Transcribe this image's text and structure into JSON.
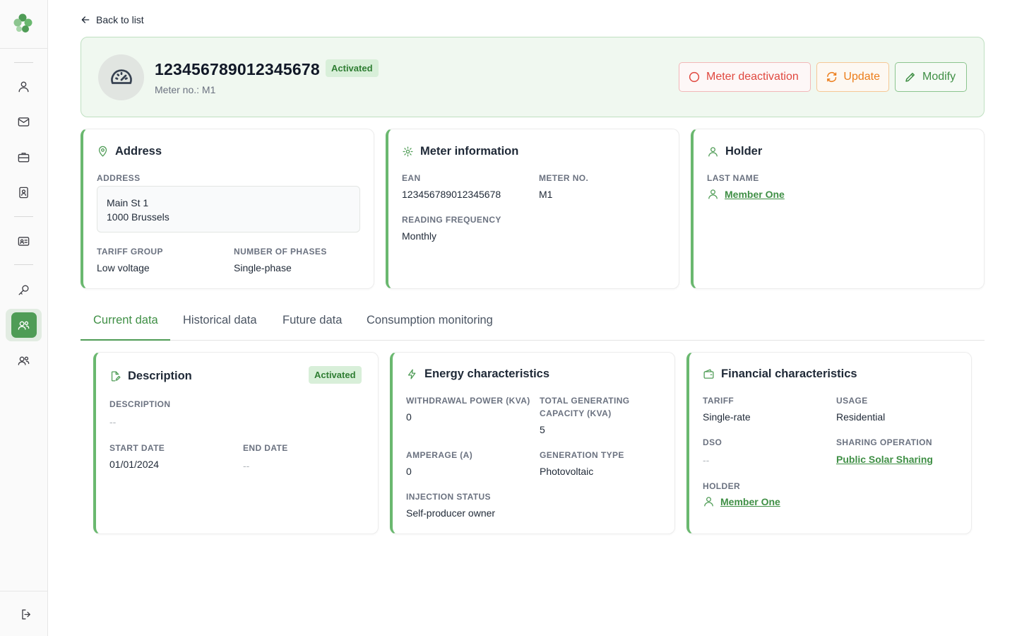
{
  "sidebar": {
    "logo": "clover-logo",
    "items": [
      {
        "icon": "user-icon"
      },
      {
        "icon": "mail-icon"
      },
      {
        "icon": "briefcase-icon"
      },
      {
        "icon": "contact-book-icon"
      },
      {
        "icon": "id-card-icon"
      },
      {
        "icon": "key-icon"
      },
      {
        "icon": "community-icon",
        "active": true
      },
      {
        "icon": "users-icon"
      }
    ],
    "logout_icon": "logout-icon"
  },
  "back_link": "Back to list",
  "header": {
    "title": "123456789012345678",
    "status": "Activated",
    "subtitle": "Meter no.: M1",
    "buttons": {
      "deactivate": "Meter deactivation",
      "update": "Update",
      "modify": "Modify"
    }
  },
  "address_card": {
    "title": "Address",
    "address_label": "ADDRESS",
    "address_line1": "Main St 1",
    "address_line2": "1000 Brussels",
    "tariff_group_label": "TARIFF GROUP",
    "tariff_group": "Low voltage",
    "phases_label": "NUMBER OF PHASES",
    "phases": "Single-phase"
  },
  "meter_card": {
    "title": "Meter information",
    "ean_label": "EAN",
    "ean": "123456789012345678",
    "meter_no_label": "METER NO.",
    "meter_no": "M1",
    "frequency_label": "READING FREQUENCY",
    "frequency": "Monthly"
  },
  "holder_card": {
    "title": "Holder",
    "last_name_label": "LAST NAME",
    "last_name": "Member One"
  },
  "tabs": [
    "Current data",
    "Historical data",
    "Future data",
    "Consumption monitoring"
  ],
  "description_card": {
    "title": "Description",
    "status": "Activated",
    "description_label": "DESCRIPTION",
    "description": "--",
    "start_label": "START DATE",
    "start": "01/01/2024",
    "end_label": "END DATE",
    "end": "--"
  },
  "energy_card": {
    "title": "Energy characteristics",
    "withdrawal_label": "WITHDRAWAL POWER (KVA)",
    "withdrawal": "0",
    "generating_label_1": "TOTAL GENERATING",
    "generating_label_2": "CAPACITY (KVA)",
    "generating": "5",
    "amperage_label": "AMPERAGE (A)",
    "amperage": "0",
    "generation_type_label": "GENERATION TYPE",
    "generation_type": "Photovoltaic",
    "injection_label": "INJECTION STATUS",
    "injection": "Self-producer owner"
  },
  "financial_card": {
    "title": "Financial characteristics",
    "tariff_label": "TARIFF",
    "tariff": "Single-rate",
    "usage_label": "USAGE",
    "usage": "Residential",
    "dso_label": "DSO",
    "dso": "--",
    "sharing_label": "SHARING OPERATION",
    "sharing": "Public Solar Sharing",
    "holder_label": "HOLDER",
    "holder": "Member One"
  },
  "colors": {
    "accent": "#4f9c56",
    "danger": "#e0483f",
    "warning": "#ec7d1a"
  }
}
